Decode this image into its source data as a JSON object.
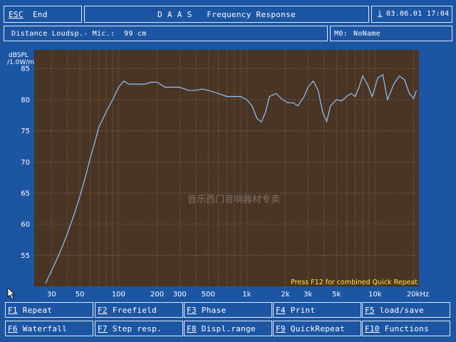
{
  "header": {
    "esc_key": "ESC",
    "esc_label": "End",
    "title": "D A A S   Frequency Response",
    "info_key": "i",
    "datetime": "03.06.01 17:04"
  },
  "subheader": {
    "distance": "Distance Loudsp.- Mic.:  99 cm",
    "m0_key": "M0:",
    "m0_value": "NoName"
  },
  "plot": {
    "ylabel_line1": "dBSPL",
    "ylabel_line2": "/1.0W/m",
    "hint": "Press F12 for combined Quick Repeat",
    "watermark": "音乐西门音响器材专卖",
    "colors": {
      "background": "#4a3424",
      "grid": "#8f7f6a",
      "curve": "#8ec4ff"
    }
  },
  "function_keys": [
    {
      "key": "F1",
      "label": " Repeat"
    },
    {
      "key": "F2",
      "label": " Freefield"
    },
    {
      "key": "F3",
      "label": " Phase"
    },
    {
      "key": "F4",
      "label": " Print"
    },
    {
      "key": "F5",
      "label": " load/save"
    },
    {
      "key": "F6",
      "label": " Waterfall"
    },
    {
      "key": "F7",
      "label": " Step resp."
    },
    {
      "key": "F8",
      "label": " Displ.range"
    },
    {
      "key": "F9",
      "label": " QuickRepeat"
    },
    {
      "key": "F10",
      "label": " Functions"
    }
  ],
  "chart_data": {
    "type": "line",
    "title": "Frequency Response",
    "ylabel": "dBSPL /1.0W/m",
    "xlabel": "",
    "x_scale": "log",
    "xlim": [
      22,
      22000
    ],
    "ylim": [
      50,
      88
    ],
    "grid": true,
    "xticks": [
      30,
      50,
      100,
      200,
      300,
      500,
      1000,
      2000,
      3000,
      5000,
      10000,
      20000
    ],
    "xtick_labels": [
      "30",
      "50",
      "100",
      "200",
      "300",
      "500",
      "1k",
      "2k",
      "3k",
      "5k",
      "10k",
      "20kHz"
    ],
    "yticks": [
      55,
      60,
      65,
      70,
      75,
      80,
      85
    ],
    "series": [
      {
        "x": [
          27,
          30,
          35,
          40,
          45,
          50,
          55,
          60,
          65,
          70,
          80,
          90,
          100,
          110,
          120,
          140,
          160,
          180,
          200,
          230,
          260,
          300,
          350,
          400,
          450,
          500,
          600,
          700,
          800,
          900,
          1000,
          1100,
          1200,
          1300,
          1400,
          1500,
          1700,
          1900,
          2100,
          2300,
          2500,
          2800,
          3000,
          3300,
          3600,
          3900,
          4200,
          4500,
          5000,
          5500,
          6000,
          6500,
          7000,
          7500,
          8000,
          8700,
          9500,
          10500,
          11500,
          12500,
          14000,
          15500,
          17000,
          18500,
          20000,
          21000
        ],
        "y": [
          50.5,
          52.5,
          55.5,
          58.5,
          61.5,
          64.5,
          67.5,
          70.5,
          73,
          75.5,
          78,
          80,
          82,
          83,
          82.5,
          82.5,
          82.5,
          82.8,
          82.8,
          82,
          82,
          82,
          81.5,
          81.5,
          81.7,
          81.5,
          81,
          80.5,
          80.5,
          80.5,
          80,
          79,
          77,
          76.4,
          78,
          80.5,
          81,
          80,
          79.5,
          79.5,
          79,
          80.5,
          82,
          83,
          81.5,
          78,
          76.5,
          79,
          80,
          79.8,
          80.5,
          81,
          80.5,
          82,
          83.8,
          82.5,
          80.5,
          83.5,
          84,
          80,
          82.5,
          83.8,
          83.2,
          81,
          80.2,
          81.5
        ]
      }
    ]
  }
}
